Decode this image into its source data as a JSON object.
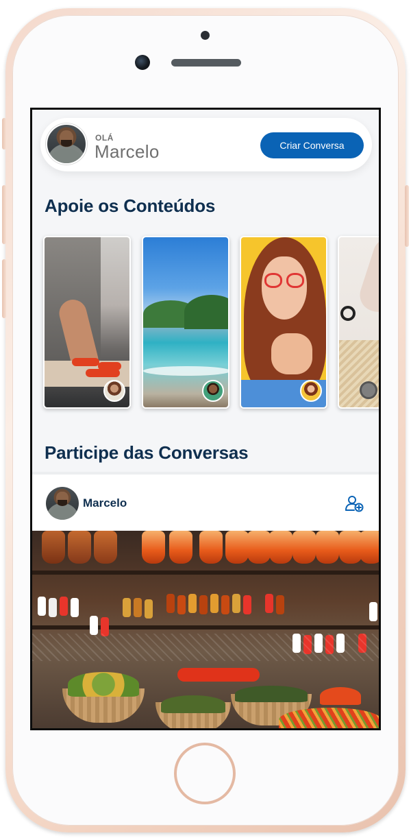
{
  "header": {
    "greeting_small": "OLÁ",
    "user_name": "Marcelo",
    "create_button": "Criar Conversa"
  },
  "sections": {
    "support_title": "Apoie os Conteúdos",
    "conversations_title": "Participe das Conversas"
  },
  "post": {
    "author": "Marcelo"
  },
  "colors": {
    "accent": "#0a63b5",
    "heading": "#0f2f4f",
    "muted": "#6f6f6f"
  },
  "icons": {
    "follow": "user-plus-icon"
  }
}
